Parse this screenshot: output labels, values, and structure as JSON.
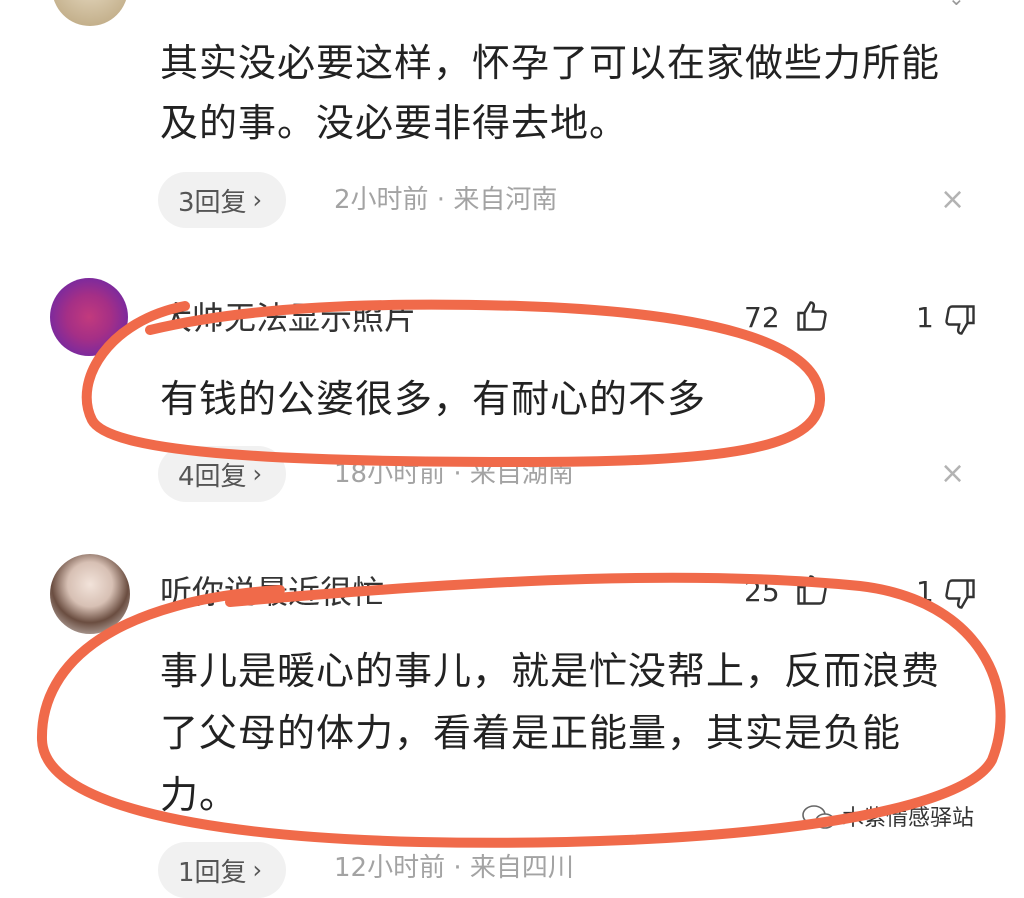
{
  "comments": [
    {
      "text_line1": "其实没必要这样，怀孕了可以在家做些力所能",
      "text_line2": "及的事。没必要非得去地。",
      "replies": "3回复",
      "meta": "2小时前 · 来自河南"
    },
    {
      "username": "大帅无法显示照片",
      "likes": "72",
      "dislikes": "1",
      "text_line1": "有钱的公婆很多，有耐心的不多",
      "replies": "4回复",
      "meta": "18小时前 · 来自湖南"
    },
    {
      "username": "听你说最近很忙",
      "likes": "25",
      "dislikes": "1",
      "text_line1": "事儿是暖心的事儿，就是忙没帮上，反而浪费",
      "text_line2": "了父母的体力，看着是正能量，其实是负能",
      "text_line3": "力。",
      "replies": "1回复",
      "meta": "12小时前 · 来自四川"
    }
  ],
  "ui": {
    "chevron": "›",
    "close": "×"
  },
  "watermark": {
    "text": "木紫情感驿站"
  },
  "colors": {
    "annotation": "#f06a4a",
    "meta": "#a3a3a3",
    "pill": "#f1f1f1"
  }
}
